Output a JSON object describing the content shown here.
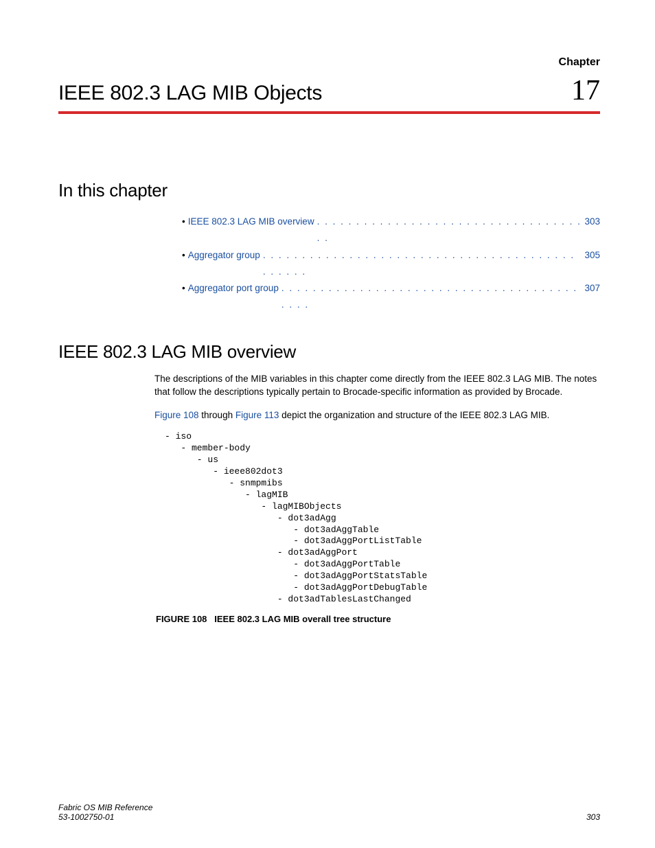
{
  "header": {
    "chapter_label": "Chapter",
    "number": "17",
    "title": "IEEE 802.3 LAG MIB Objects"
  },
  "sections": {
    "in_this_chapter": "In this chapter",
    "overview": "IEEE 802.3 LAG MIB overview"
  },
  "toc": [
    {
      "label": "IEEE 802.3 LAG MIB overview",
      "page": "303"
    },
    {
      "label": "Aggregator group",
      "page": "305"
    },
    {
      "label": "Aggregator port group",
      "page": "307"
    }
  ],
  "body": {
    "p1": "The descriptions of the MIB variables in this chapter come directly from the IEEE 802.3 LAG MIB. The notes that follow the descriptions typically pertain to Brocade-specific information as provided by Brocade.",
    "p2_prefix": "Figure 108",
    "p2_mid1": " through ",
    "p2_link2": "Figure 113",
    "p2_suffix": " depict the organization and structure of the IEEE 802.3 LAG MIB."
  },
  "tree": "- iso\n   - member-body\n      - us\n         - ieee802dot3\n            - snmpmibs\n               - lagMIB\n                  - lagMIBObjects\n                     - dot3adAgg\n                        - dot3adAggTable\n                        - dot3adAggPortListTable\n                     - dot3adAggPort\n                        - dot3adAggPortTable\n                        - dot3adAggPortStatsTable\n                        - dot3adAggPortDebugTable\n                     - dot3adTablesLastChanged",
  "figure": {
    "label": "FIGURE 108",
    "title": "IEEE 802.3 LAG MIB overall tree structure"
  },
  "footer": {
    "doc_title": "Fabric OS MIB Reference",
    "doc_number": "53-1002750-01",
    "page_number": "303"
  }
}
